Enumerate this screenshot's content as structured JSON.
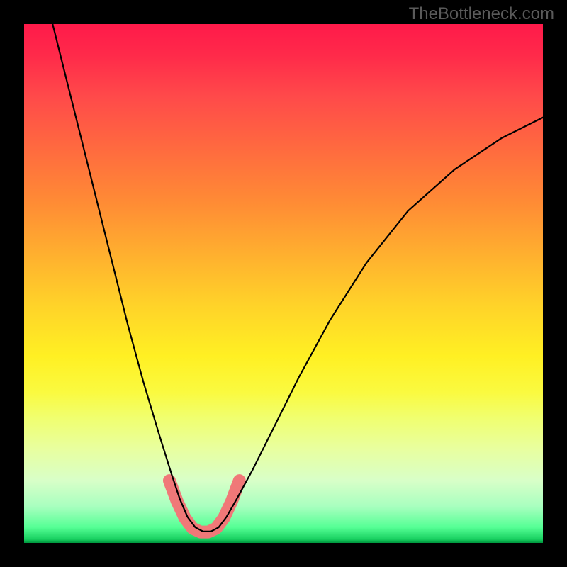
{
  "watermark": "TheBottleneck.com",
  "chart_data": {
    "type": "line",
    "title": "",
    "xlabel": "",
    "ylabel": "",
    "xlim": [
      0,
      100
    ],
    "ylim": [
      0,
      100
    ],
    "series": [
      {
        "name": "black-curve",
        "stroke": "#000000",
        "stroke_width": 2,
        "points": [
          [
            5.5,
            100
          ],
          [
            8,
            90
          ],
          [
            11,
            78
          ],
          [
            14,
            66
          ],
          [
            17,
            54
          ],
          [
            20,
            42
          ],
          [
            23,
            31
          ],
          [
            26,
            21
          ],
          [
            28.5,
            13
          ],
          [
            30,
            8.5
          ],
          [
            31.5,
            5
          ],
          [
            33,
            3
          ],
          [
            34.5,
            2.2
          ],
          [
            36,
            2.2
          ],
          [
            37.5,
            3
          ],
          [
            39,
            5
          ],
          [
            41,
            8.5
          ],
          [
            44,
            14
          ],
          [
            48,
            22
          ],
          [
            53,
            32
          ],
          [
            59,
            43
          ],
          [
            66,
            54
          ],
          [
            74,
            64
          ],
          [
            83,
            72
          ],
          [
            92,
            78
          ],
          [
            100,
            82
          ]
        ]
      },
      {
        "name": "pink-bottom",
        "stroke": "#f07878",
        "stroke_width": 12,
        "points": [
          [
            28,
            12
          ],
          [
            29.5,
            8
          ],
          [
            31,
            4.8
          ],
          [
            32.5,
            2.8
          ],
          [
            34,
            2.1
          ],
          [
            35.5,
            2.1
          ],
          [
            37,
            2.8
          ],
          [
            38.5,
            4.8
          ],
          [
            40,
            8
          ],
          [
            41.5,
            12
          ]
        ]
      }
    ]
  }
}
